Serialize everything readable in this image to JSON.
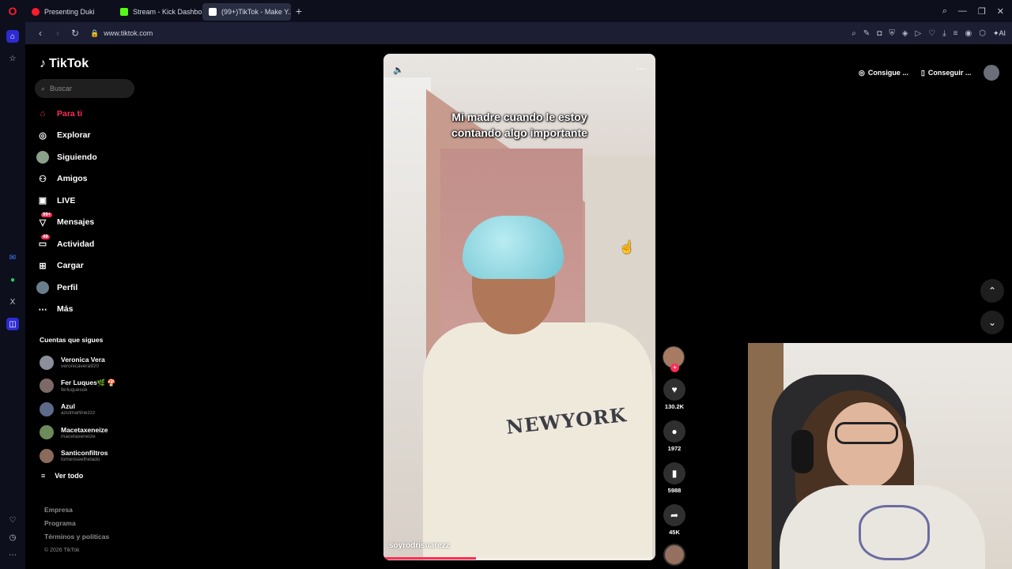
{
  "browser": {
    "tabs": [
      {
        "title": "Presenting Duki",
        "favicon_color": "#ff1b2d"
      },
      {
        "title": "Stream - Kick Dashboard",
        "favicon_color": "#53fc18"
      },
      {
        "title": "(99+)TikTok - Make Y...",
        "favicon_color": "#ffffff"
      }
    ],
    "url": "www.tiktok.com",
    "ai_label": "AI"
  },
  "tiktok": {
    "logo_text": "TikTok",
    "search_placeholder": "Buscar",
    "nav": [
      {
        "label": "Para ti",
        "icon": "home-icon"
      },
      {
        "label": "Explorar",
        "icon": "compass-icon"
      },
      {
        "label": "Siguiendo",
        "icon": "avatar"
      },
      {
        "label": "Amigos",
        "icon": "friends-icon"
      },
      {
        "label": "LIVE",
        "icon": "live-icon"
      },
      {
        "label": "Mensajes",
        "icon": "message-icon",
        "badge": "99+"
      },
      {
        "label": "Actividad",
        "icon": "activity-icon",
        "badge": "49"
      },
      {
        "label": "Cargar",
        "icon": "upload-icon"
      },
      {
        "label": "Perfil",
        "icon": "profile-avatar"
      },
      {
        "label": "Más",
        "icon": "more-icon"
      }
    ],
    "following_title": "Cuentas que sigues",
    "following": [
      {
        "name": "Veronica Vera",
        "user": "veronicavera920",
        "color": "#8a8f99"
      },
      {
        "name": "Fer Luques🌿 🍄",
        "user": "ferluquesok",
        "color": "#7d6a66"
      },
      {
        "name": "Azul",
        "user": "azulmartinezzz",
        "color": "#5e6a8a"
      },
      {
        "name": "Macetaxeneize",
        "user": "macetaxeneize",
        "color": "#6d8a5a"
      },
      {
        "name": "Santiconfiltros",
        "user": "tomenseelhelado",
        "color": "#8a6a5a"
      }
    ],
    "see_all": "Ver todo",
    "footer": [
      "Empresa",
      "Programa",
      "Términos y políticas"
    ],
    "copyright": "© 2026 TikTok",
    "top_right": {
      "get_coins": "Consigue ...",
      "get_app": "Conseguir ..."
    },
    "video": {
      "caption_line1": "Mi madre cuando le estoy",
      "caption_line2": "contando algo importante",
      "username": "soyrodrisuarezz",
      "shirt_text": "NEWYORK",
      "progress": 0.34
    },
    "actions": {
      "likes": "130.2K",
      "comments": "1972",
      "saves": "5988",
      "shares": "45K"
    }
  }
}
